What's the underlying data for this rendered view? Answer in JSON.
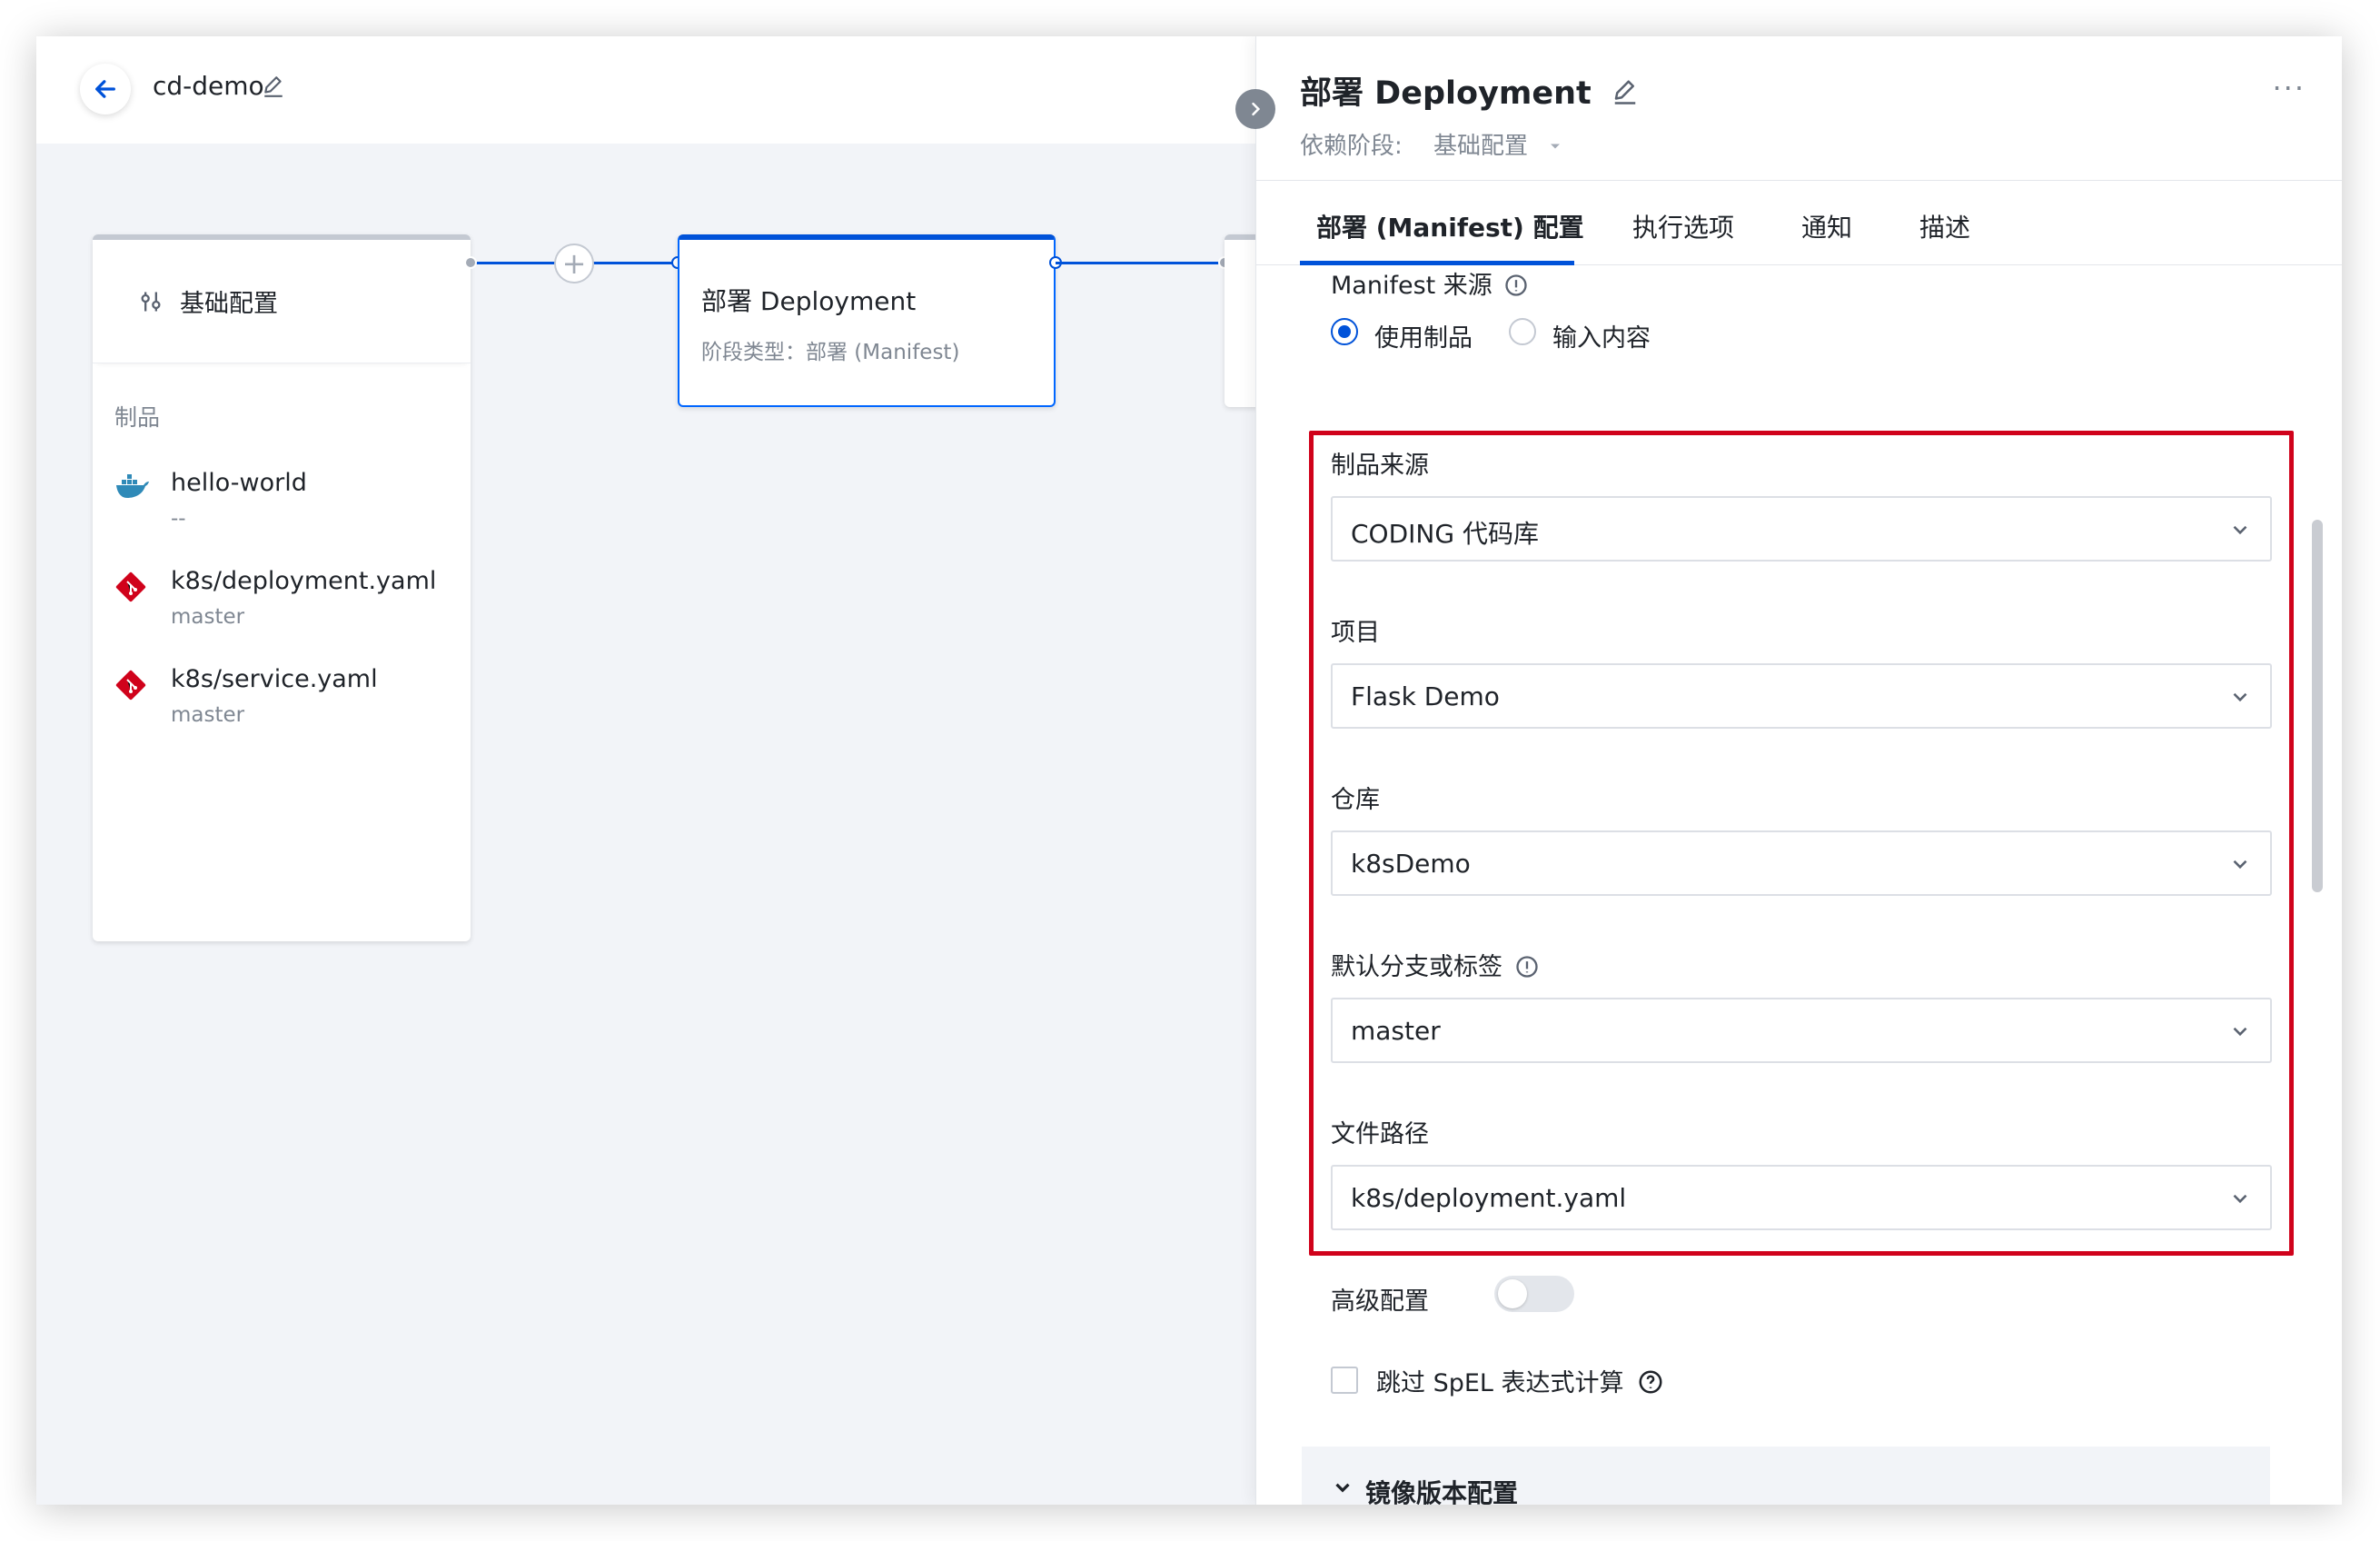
{
  "header": {
    "pipeline_name": "cd-demo"
  },
  "stages": {
    "basic": {
      "title": "基础配置",
      "artifacts_label": "制品",
      "artifacts": [
        {
          "name": "hello-world",
          "sub": "--",
          "icon": "docker-icon"
        },
        {
          "name": "k8s/deployment.yaml",
          "sub": "master",
          "icon": "git-icon"
        },
        {
          "name": "k8s/service.yaml",
          "sub": "master",
          "icon": "git-icon"
        }
      ]
    },
    "deploy": {
      "title": "部署 Deployment",
      "subtitle": "阶段类型：部署 (Manifest)"
    }
  },
  "panel": {
    "title": "部署 Deployment",
    "depends_label": "依赖阶段:",
    "depends_value": "基础配置",
    "tabs": [
      {
        "label": "部署 (Manifest) 配置",
        "active": true
      },
      {
        "label": "执行选项"
      },
      {
        "label": "通知"
      },
      {
        "label": "描述"
      }
    ],
    "manifest_source_label": "Manifest 来源",
    "radio_use_artifact": "使用制品",
    "radio_input_content": "输入内容",
    "fields": {
      "artifact_source": {
        "label": "制品来源",
        "value": "CODING 代码库"
      },
      "project": {
        "label": "项目",
        "value": "Flask Demo"
      },
      "repo": {
        "label": "仓库",
        "value": "k8sDemo"
      },
      "branch": {
        "label": "默认分支或标签",
        "value": "master"
      },
      "file_path": {
        "label": "文件路径",
        "value": "k8s/deployment.yaml"
      }
    },
    "advanced_label": "高级配置",
    "skip_spel_label": "跳过 SpEL 表达式计算",
    "image_section_label": "镜像版本配置"
  },
  "colors": {
    "accent": "#0052d9",
    "highlight_border": "#d0021b"
  }
}
